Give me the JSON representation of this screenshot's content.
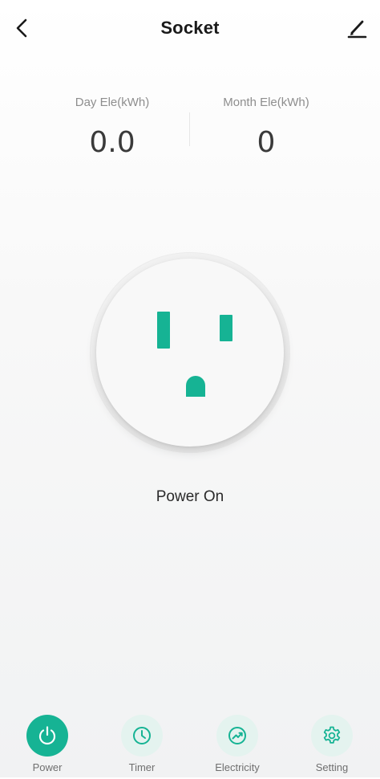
{
  "header": {
    "title": "Socket",
    "back_icon": "chevron-left-icon",
    "edit_icon": "pencil-icon"
  },
  "stats": {
    "day": {
      "label": "Day Ele(kWh)",
      "value": "0.0"
    },
    "month": {
      "label": "Month Ele(kWh)",
      "value": "0"
    }
  },
  "socket": {
    "status": "Power On",
    "accent_color": "#16b394"
  },
  "bottom_nav": {
    "items": [
      {
        "label": "Power",
        "icon": "power-icon",
        "active": true
      },
      {
        "label": "Timer",
        "icon": "clock-icon",
        "active": false
      },
      {
        "label": "Electricity",
        "icon": "trend-up-icon",
        "active": false
      },
      {
        "label": "Setting",
        "icon": "gear-icon",
        "active": false
      }
    ]
  },
  "colors": {
    "accent": "#16b394",
    "accent_light": "#e4f3ef",
    "text_primary": "#1a1a1a",
    "text_secondary": "#8e8e8e"
  }
}
